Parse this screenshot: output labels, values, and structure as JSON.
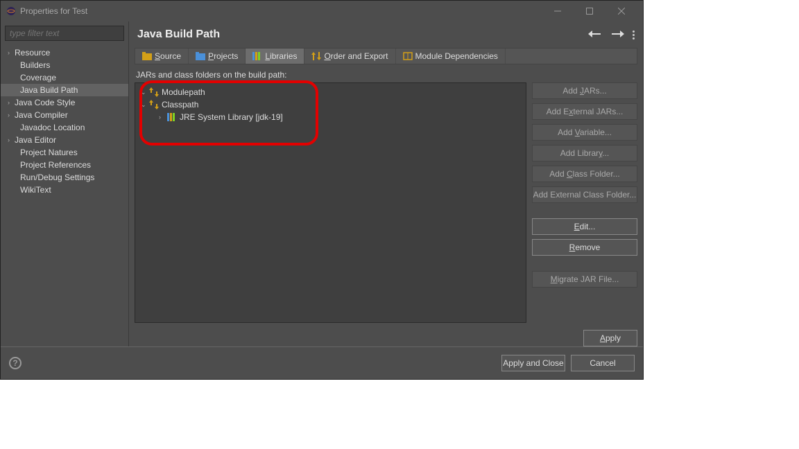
{
  "window": {
    "title": "Properties for Test"
  },
  "filter": {
    "placeholder": "type filter text"
  },
  "sidebar": {
    "items": [
      {
        "label": "Resource",
        "expandable": true
      },
      {
        "label": "Builders",
        "expandable": false
      },
      {
        "label": "Coverage",
        "expandable": false
      },
      {
        "label": "Java Build Path",
        "expandable": false,
        "selected": true
      },
      {
        "label": "Java Code Style",
        "expandable": true
      },
      {
        "label": "Java Compiler",
        "expandable": true
      },
      {
        "label": "Javadoc Location",
        "expandable": false
      },
      {
        "label": "Java Editor",
        "expandable": true
      },
      {
        "label": "Project Natures",
        "expandable": false
      },
      {
        "label": "Project References",
        "expandable": false
      },
      {
        "label": "Run/Debug Settings",
        "expandable": false
      },
      {
        "label": "WikiText",
        "expandable": false
      }
    ]
  },
  "main": {
    "heading": "Java Build Path",
    "tabs": [
      {
        "label": "Source",
        "ul": "S"
      },
      {
        "label": "Projects",
        "ul": "P"
      },
      {
        "label": "Libraries",
        "ul": "L",
        "active": true
      },
      {
        "label": "Order and Export",
        "ul": "O"
      },
      {
        "label": "Module Dependencies"
      }
    ],
    "subtitle": "JARs and class folders on the build path:",
    "libtree": {
      "modulepath_label": "Modulepath",
      "classpath_label": "Classpath",
      "jre_label": "JRE System Library [jdk-19]"
    },
    "buttons": {
      "add_jars": "Add JARs...",
      "add_ext_jars": "Add External JARs...",
      "add_variable": "Add Variable...",
      "add_library": "Add Library...",
      "add_class_folder": "Add Class Folder...",
      "add_ext_class_folder": "Add External Class Folder...",
      "edit": "Edit...",
      "remove": "Remove",
      "migrate": "Migrate JAR File...",
      "apply": "Apply"
    }
  },
  "footer": {
    "apply_close": "Apply and Close",
    "cancel": "Cancel"
  }
}
